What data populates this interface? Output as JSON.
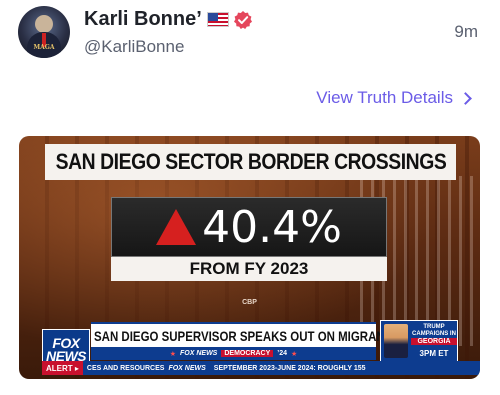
{
  "post": {
    "display_name": "Karli Bonne’",
    "handle": "@KarliBonne",
    "time": "9m",
    "details_link": "View Truth Details"
  },
  "avatar": {
    "text": "MAGA"
  },
  "icons": {
    "flag": "us-flag-icon",
    "verified": "verified-badge-icon",
    "chevron": "chevron-right-icon",
    "arrow": "up-triangle-icon"
  },
  "colors": {
    "link": "#6b5ce7",
    "verified": "#e5465c",
    "fox_blue": "#0d3c8f",
    "alert_red": "#c8102e"
  },
  "media": {
    "headline": "SAN DIEGO SECTOR BORDER CROSSINGS",
    "stat_value": "40.4%",
    "stat_sub": "FROM FY 2023",
    "source": "CBP",
    "logo_line1": "FOX",
    "logo_line2": "NEWS",
    "chyron_main": "SAN DIEGO SUPERVISOR SPEAKS OUT ON MIGRANT CRISIS",
    "chyron_sub_brand": "FOX NEWS",
    "chyron_sub_tag": "DEMOCRACY",
    "chyron_sub_year": "’24",
    "promo_line1": "TRUMP CAMPAIGNS IN",
    "promo_line2": "GEORGIA",
    "promo_line3": "3PM ET",
    "ticker_alert": "ALERT ▸",
    "ticker_text1": "CES AND RESOURCES",
    "ticker_brand": "FOX NEWS",
    "ticker_text2": "SEPTEMBER 2023-JUNE 2024: ROUGHLY 155"
  }
}
